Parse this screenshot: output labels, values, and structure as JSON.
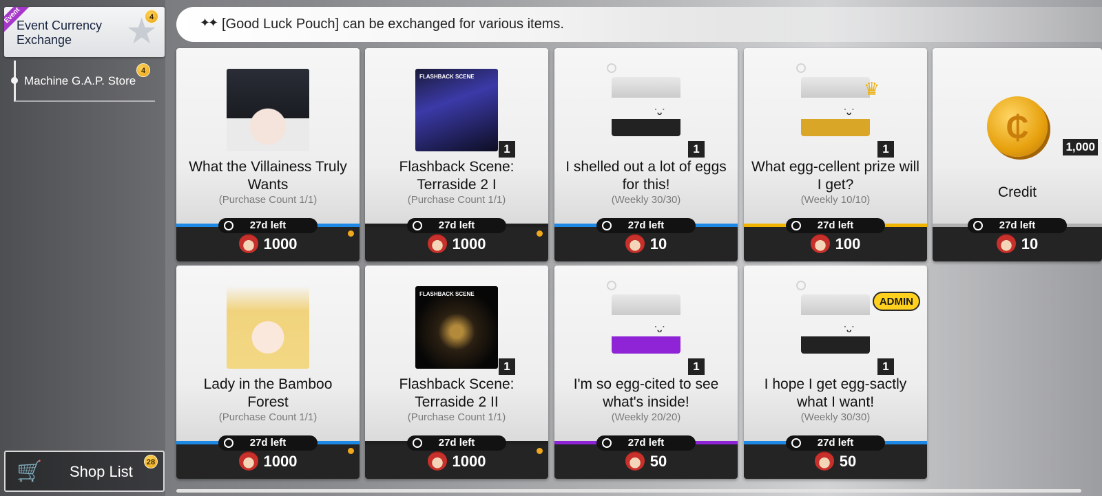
{
  "sidebar": {
    "event_tab": {
      "ribbon": "Event",
      "label": "Event Currency Exchange",
      "badge": "4"
    },
    "machine_tab": {
      "label": "Machine G.A.P. Store",
      "badge": "4"
    },
    "shop_list": {
      "label": "Shop List",
      "badge": "28"
    }
  },
  "banner": {
    "text": "[Good Luck Pouch] can be exchanged for various items."
  },
  "items": [
    {
      "title": "What the Villainess Truly Wants",
      "sub": "(Purchase Count 1/1)",
      "timer": "27d left",
      "price": "1000",
      "qty": "",
      "strip": "#1e88e5",
      "dot": true
    },
    {
      "title": "Flashback Scene: Terraside 2 I",
      "sub": "(Purchase Count 1/1)",
      "timer": "27d left",
      "price": "1000",
      "qty": "1",
      "strip": "#1f1f1f",
      "dot": true,
      "art_tag": "FLASHBACK SCENE"
    },
    {
      "title": "I shelled out a lot of eggs for this!",
      "sub": "(Weekly 30/30)",
      "timer": "27d left",
      "price": "10",
      "qty": "1",
      "strip": "#1e88e5",
      "dot": false
    },
    {
      "title": "What egg-cellent prize will I get?",
      "sub": "(Weekly 10/10)",
      "timer": "27d left",
      "price": "100",
      "qty": "1",
      "strip": "#f0b400",
      "dot": false
    },
    {
      "title": "Credit",
      "sub": "",
      "timer": "27d left",
      "price": "10",
      "qty": "1,000",
      "strip": "#b0b0b0",
      "dot": false
    },
    {
      "title": "Lady in the Bamboo Forest",
      "sub": "(Purchase Count 1/1)",
      "timer": "27d left",
      "price": "1000",
      "qty": "",
      "strip": "#1e88e5",
      "dot": true
    },
    {
      "title": "Flashback Scene: Terraside 2 II",
      "sub": "(Purchase Count 1/1)",
      "timer": "27d left",
      "price": "1000",
      "qty": "1",
      "strip": "#1f1f1f",
      "dot": true,
      "art_tag": "FLASHBACK SCENE"
    },
    {
      "title": "I'm so egg-cited to see what's inside!",
      "sub": "(Weekly 20/20)",
      "timer": "27d left",
      "price": "50",
      "qty": "1",
      "strip": "#8e24d6",
      "dot": false
    },
    {
      "title": "I hope I get egg-sactly what I want!",
      "sub": "(Weekly 30/30)",
      "timer": "27d left",
      "price": "50",
      "qty": "1",
      "strip": "#1e88e5",
      "dot": false,
      "badge": "ADMIN"
    }
  ],
  "icons": {
    "currency": "good-luck-pouch-icon",
    "timer": "clock-icon",
    "cart": "shopping-cart-icon"
  }
}
